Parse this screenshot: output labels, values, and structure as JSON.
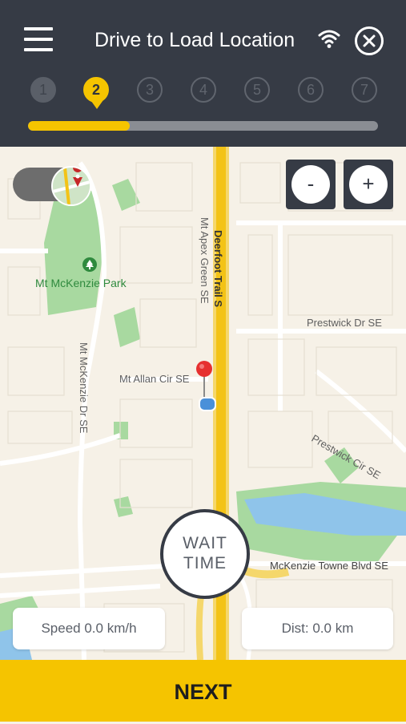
{
  "header": {
    "title": "Drive to Load Location",
    "menu_icon": "hamburger-menu-icon",
    "wifi_icon": "wifi-icon",
    "close_icon": "close-icon",
    "colors": {
      "background": "#363b45",
      "accent": "#f5c400"
    }
  },
  "steps": [
    {
      "label": "1",
      "state": "done"
    },
    {
      "label": "2",
      "state": "active"
    },
    {
      "label": "3",
      "state": "pending"
    },
    {
      "label": "4",
      "state": "pending"
    },
    {
      "label": "5",
      "state": "pending"
    },
    {
      "label": "6",
      "state": "pending"
    },
    {
      "label": "7",
      "state": "pending"
    }
  ],
  "progress": {
    "fraction": 0.29
  },
  "map": {
    "zoom_out_label": "-",
    "zoom_in_label": "+",
    "labels": {
      "park": "Mt McKenzie Park",
      "deerfoot": "Deerfoot Trail S",
      "apex": "Mt Apex Green SE",
      "mckenzie_dr": "Mt McKenzie Dr SE",
      "prestwick_dr": "Prestwick Dr SE",
      "allan": "Mt Allan Cir SE",
      "prestwick_cir": "Prestwick Cir SE",
      "towne_blvd": "McKenzie Towne Blvd SE"
    },
    "pin_icon": "map-pin-icon",
    "location_icon": "current-location-icon"
  },
  "wait_time": {
    "line1": "WAIT",
    "line2": "TIME"
  },
  "speed": {
    "text": "Speed 0.0 km/h"
  },
  "distance": {
    "text": "Dist: 0.0 km"
  },
  "next": {
    "label": "NEXT"
  }
}
